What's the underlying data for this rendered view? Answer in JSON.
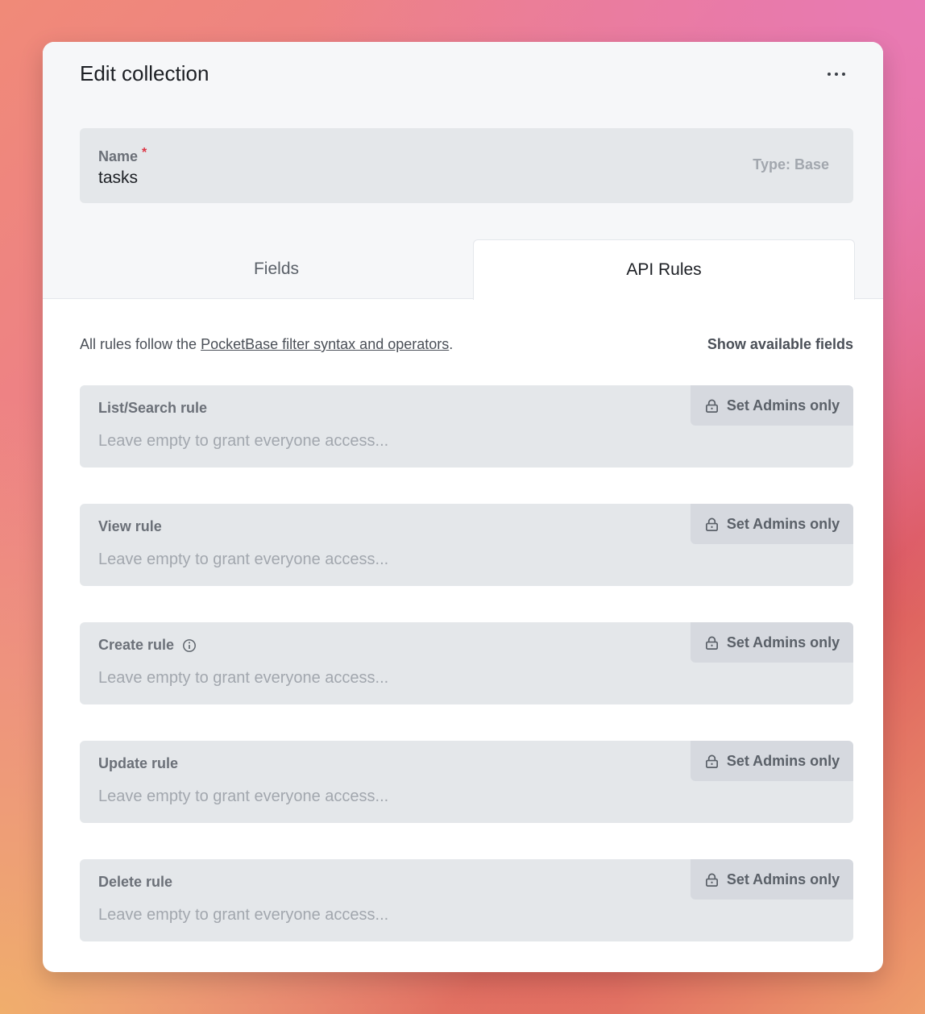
{
  "modal": {
    "title": "Edit collection",
    "more_icon": "more-horizontal-icon"
  },
  "name_field": {
    "label": "Name",
    "required_marker": "*",
    "value": "tasks",
    "type_label": "Type: Base"
  },
  "tabs": [
    {
      "label": "Fields",
      "active": false
    },
    {
      "label": "API Rules",
      "active": true
    }
  ],
  "intro": {
    "prefix": "All rules follow the",
    "link": "PocketBase filter syntax and operators",
    "suffix": ".",
    "show_fields": "Show available fields"
  },
  "rules": [
    {
      "label": "List/Search rule",
      "placeholder": "Leave empty to grant everyone access...",
      "button": "Set Admins only",
      "info": false
    },
    {
      "label": "View rule",
      "placeholder": "Leave empty to grant everyone access...",
      "button": "Set Admins only",
      "info": false
    },
    {
      "label": "Create rule",
      "placeholder": "Leave empty to grant everyone access...",
      "button": "Set Admins only",
      "info": true
    },
    {
      "label": "Update rule",
      "placeholder": "Leave empty to grant everyone access...",
      "button": "Set Admins only",
      "info": false
    },
    {
      "label": "Delete rule",
      "placeholder": "Leave empty to grant everyone access...",
      "button": "Set Admins only",
      "info": false
    }
  ],
  "colors": {
    "required": "#dc3545",
    "field_bg": "#e4e7ea",
    "button_bg": "#d6d9df",
    "header_bg": "#f6f7f9"
  }
}
